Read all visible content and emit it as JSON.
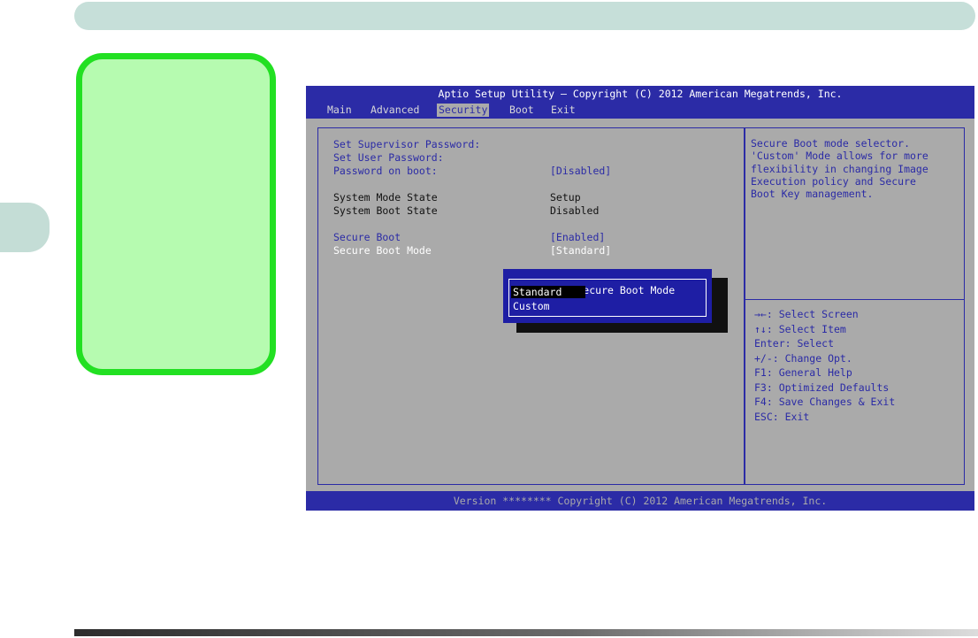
{
  "bios": {
    "title": "Aptio Setup Utility – Copyright (C) 2012 American Megatrends, Inc.",
    "tabs": [
      "Main",
      "Advanced",
      "Security",
      "Boot",
      "Exit"
    ],
    "active_tab": "Security",
    "settings": {
      "supervisor_password_label": "Set Supervisor Password:",
      "user_password_label": "Set User Password:",
      "password_on_boot_label": "Password on boot:",
      "password_on_boot_value": "[Disabled]",
      "system_mode_state_label": "System Mode State",
      "system_mode_state_value": "Setup",
      "system_boot_state_label": "System Boot State",
      "system_boot_state_value": "Disabled",
      "secure_boot_label": "Secure Boot",
      "secure_boot_value": "[Enabled]",
      "secure_boot_mode_label": "Secure Boot Mode",
      "secure_boot_mode_value": "[Standard]"
    },
    "help": {
      "description": "Secure Boot mode selector.\n'Custom' Mode allows for more\nflexibility in changing Image\nExecution policy and Secure\nBoot Key management.",
      "keys": [
        "→←: Select Screen",
        "↑↓: Select Item",
        "Enter: Select",
        "+/-: Change Opt.",
        "F1: General Help",
        "F3: Optimized Defaults",
        "F4: Save Changes & Exit",
        "ESC: Exit"
      ]
    },
    "popup": {
      "title": "Secure Boot Mode",
      "options": [
        "Standard",
        "Custom"
      ],
      "selected": "Standard"
    },
    "footer": "Version ******** Copyright (C) 2012 American Megatrends, Inc."
  },
  "colors": {
    "note_box_border": "#22e022",
    "note_box_fill": "#b6fbb0",
    "bios_blue": "#2b2ba6",
    "bios_gray": "#aaaaaa"
  }
}
